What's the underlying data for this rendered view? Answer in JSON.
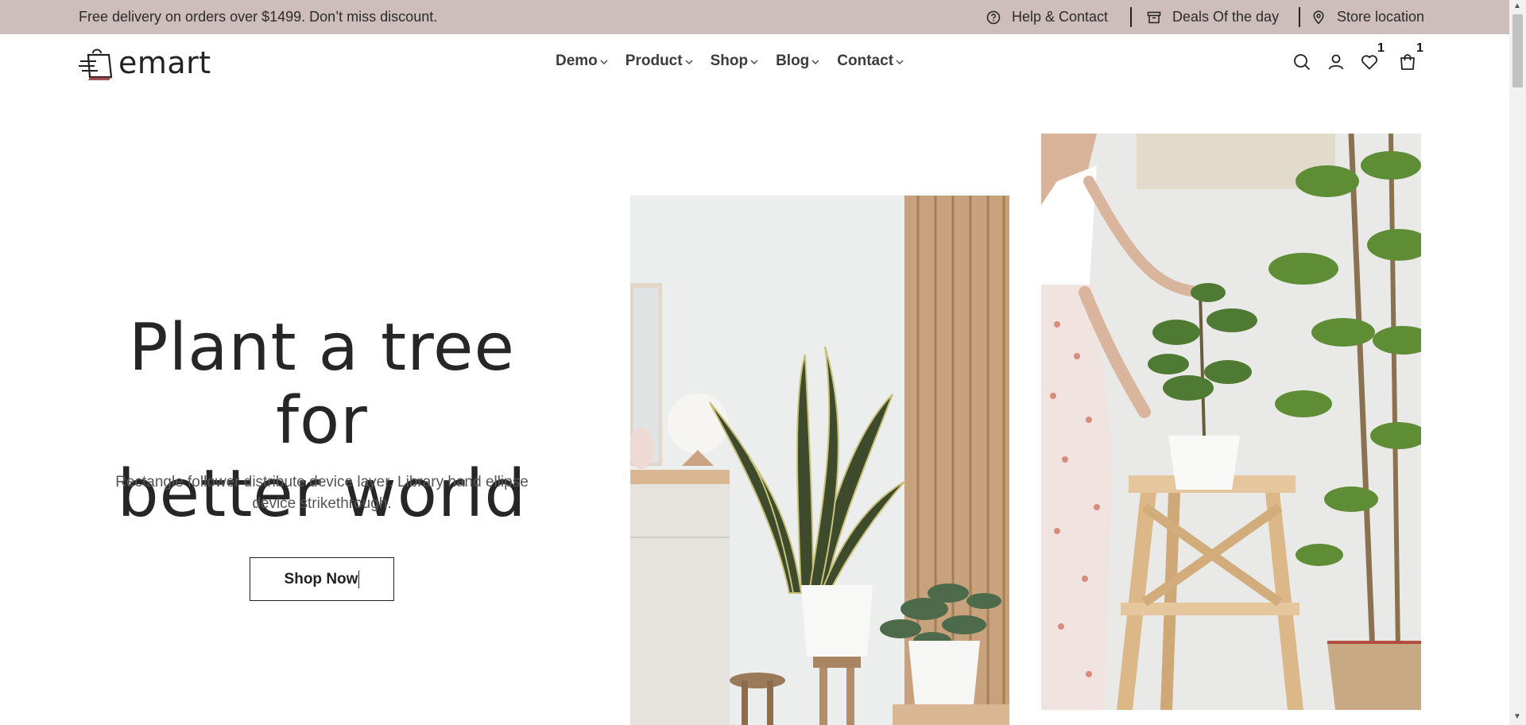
{
  "topbar": {
    "promo": "Free delivery on orders over $1499. Don’t miss discount.",
    "help": "Help & Contact",
    "deals": "Deals Of the day",
    "store": "Store location"
  },
  "logo": {
    "text": "emart"
  },
  "nav": [
    {
      "label": "Demo"
    },
    {
      "label": "Product"
    },
    {
      "label": "Shop"
    },
    {
      "label": "Blog"
    },
    {
      "label": "Contact"
    }
  ],
  "header_icons": {
    "wishlist_count": "1",
    "cart_count": "1"
  },
  "hero": {
    "title_line1": "Plant a tree for",
    "title_line2": "better world",
    "subtitle": "Rectangle follower distribute device layer. Library hand ellipse device strikethrough.",
    "button": "Shop Now"
  },
  "colors": {
    "topbar_bg": "#cdbdbb",
    "text_dark": "#262626",
    "logo_accent": "#8b2b2b"
  }
}
